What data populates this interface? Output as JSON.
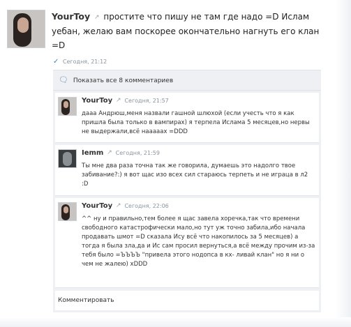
{
  "post": {
    "author": "YourToy",
    "text": "простите что пишу не там где надо =D Ислам уебан, желаю вам поскорее окончательно нагнуть его клан =D",
    "time": "Сегодня, 21:12"
  },
  "comments_block": {
    "show_all_label": "Показать все 8 комментариев",
    "items": [
      {
        "author": "YourToy",
        "time": "Сегодня, 21:57",
        "text": "дааа Андрюш,меня назвали гашной шлюхой (если учесть что я как пришла была только в вампирах) я терпела Ислама 5 месяцев,но нервы не выдержали,всё нааааах =DDD"
      },
      {
        "author": "Iemm",
        "time": "Сегодня, 21:59",
        "text": "Ты мне два раза точна так же говорила, думаешь это надолго твое забивание?:) я вот щас изо всех сил стараюсь терпеть и не играца в л2 :D"
      },
      {
        "author": "YourToy",
        "time": "Сегодня, 22:06",
        "text": "^^ ну и правильно,тем более я щас завела хоречка,так что времени свободного катастрофически мало,но тут уж точно забила,ибо начала продавать шмот =D сказала Ису всё что накопилось за 5 месяцев) а тогда я была зла,да и Ис сам просил вернуться,а всё между прочим из-за тебя было =ЪЪЪЪ \"привела этого нодопса в кх- ливай клан\" но я ни о чем не жалею) xDDD"
      }
    ],
    "add_comment_label": "Комментировать"
  },
  "icons": {
    "external": "external-link-icon",
    "check": "checkmark-icon",
    "comments": "comments-icon"
  },
  "colors": {
    "panel": "#eef0f3",
    "text": "#222222",
    "meta": "#8a939c",
    "accent": "#3d7fc0"
  }
}
